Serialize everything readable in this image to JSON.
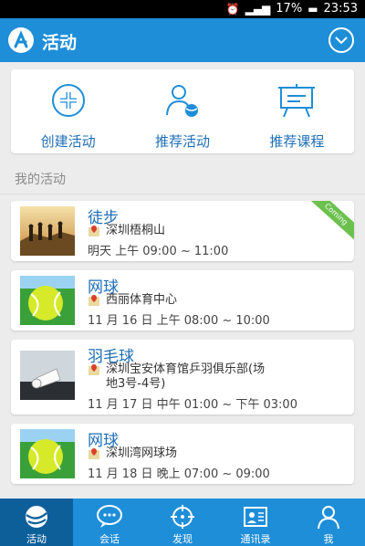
{
  "status_bar": {
    "battery": "17%",
    "time": "23:53"
  },
  "app_bar": {
    "title": "活动"
  },
  "actions": [
    {
      "label": "创建活动",
      "icon": "plus-circle-icon"
    },
    {
      "label": "推荐活动",
      "icon": "person-ball-icon"
    },
    {
      "label": "推荐课程",
      "icon": "easel-board-icon"
    }
  ],
  "section": {
    "title": "我的活动"
  },
  "activities": [
    {
      "name": "徒步",
      "location": "深圳梧桐山",
      "time": "明天 上午 09:00 ~ 11:00",
      "thumb": "hiking",
      "badge": "Coming"
    },
    {
      "name": "网球",
      "location": "西丽体育中心",
      "time": "11 月 16 日 上午 08:00 ~ 10:00",
      "thumb": "tennis-ball"
    },
    {
      "name": "羽毛球",
      "location": "深圳宝安体育馆乒羽俱乐部(场地3号-4号)",
      "location_line1": "深圳宝安体育馆乒羽俱乐部(场",
      "location_line2": "地3号-4号)",
      "time": "11 月 17 日 中午 01:00 ~ 下午 03:00",
      "thumb": "shuttlecock"
    },
    {
      "name": "网球",
      "location": "深圳湾网球场",
      "time": "11 月 18 日 晚上 07:00 ~ 09:00",
      "thumb": "tennis-ball"
    }
  ],
  "tabs": [
    {
      "label": "活动",
      "icon": "globe-icon",
      "active": true
    },
    {
      "label": "会话",
      "icon": "chat-bubble-icon"
    },
    {
      "label": "发现",
      "icon": "crosshair-icon"
    },
    {
      "label": "通讯录",
      "icon": "contact-card-icon"
    },
    {
      "label": "我",
      "icon": "person-icon"
    }
  ],
  "colors": {
    "primary": "#1e8ed8",
    "active_tab": "#0d5f9a",
    "link": "#1e6eb8",
    "badge": "#6cc14e"
  }
}
